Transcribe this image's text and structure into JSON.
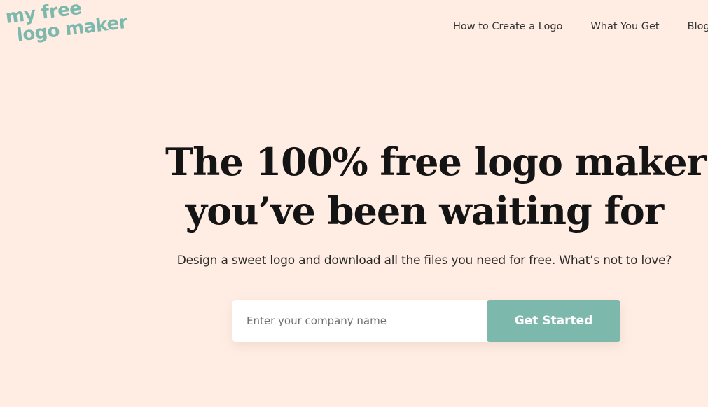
{
  "brand": {
    "logo_line1": "my free",
    "logo_line2": "logo maker",
    "accent_color": "#7db8ad",
    "background_color": "#ffede3"
  },
  "nav": {
    "items": [
      {
        "label": "How to Create a Logo"
      },
      {
        "label": "What You Get"
      },
      {
        "label": "Blog"
      }
    ]
  },
  "hero": {
    "headline_line1": "The 100% free logo maker",
    "headline_line2": "you’ve been waiting for",
    "subheadline": "Design a sweet logo and download all the files you need for free. What’s not to love?"
  },
  "form": {
    "input_placeholder": "Enter your company name",
    "input_value": "",
    "button_label": "Get Started"
  }
}
